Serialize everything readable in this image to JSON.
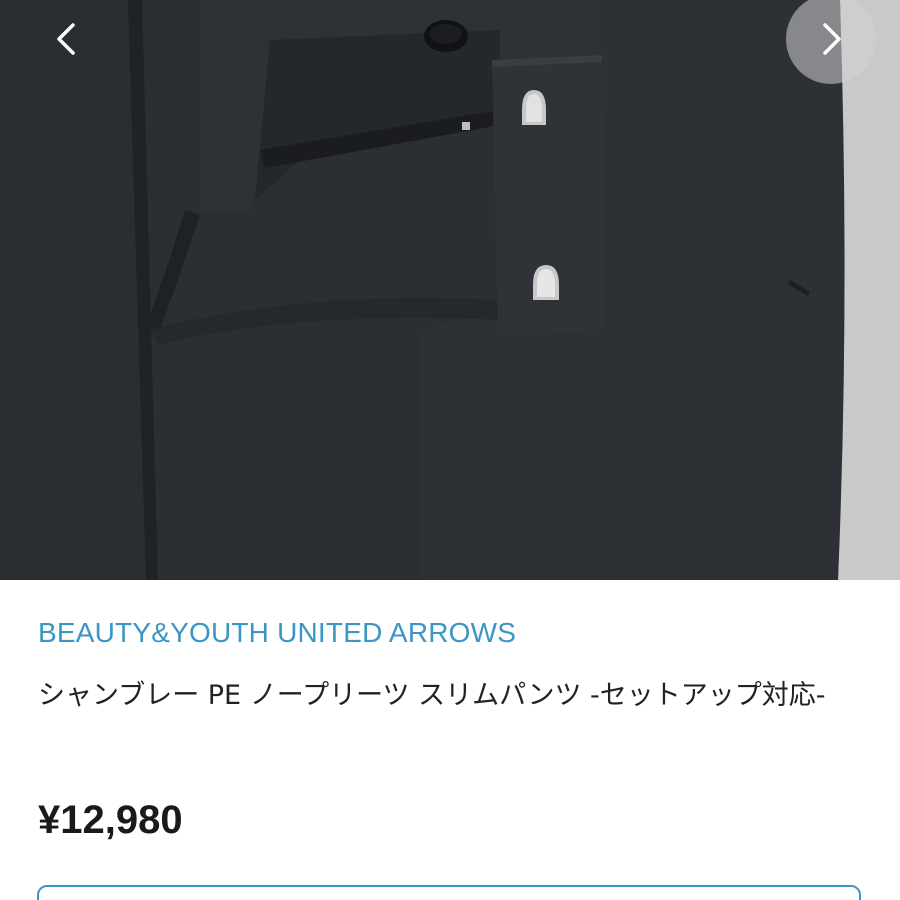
{
  "gallery": {
    "image_subject": "dark-navy-slim-pants-closeup",
    "prev_icon": "chevron-left-icon",
    "next_icon": "chevron-right-icon"
  },
  "product": {
    "brand": "BEAUTY&YOUTH UNITED ARROWS",
    "title": "シャンブレー PE ノープリーツ スリムパンツ -セットアップ対応-",
    "price": "¥12,980"
  },
  "colors": {
    "brand_link": "#3b95c5",
    "fabric": "#2a2d31",
    "background": "#ffffff"
  }
}
